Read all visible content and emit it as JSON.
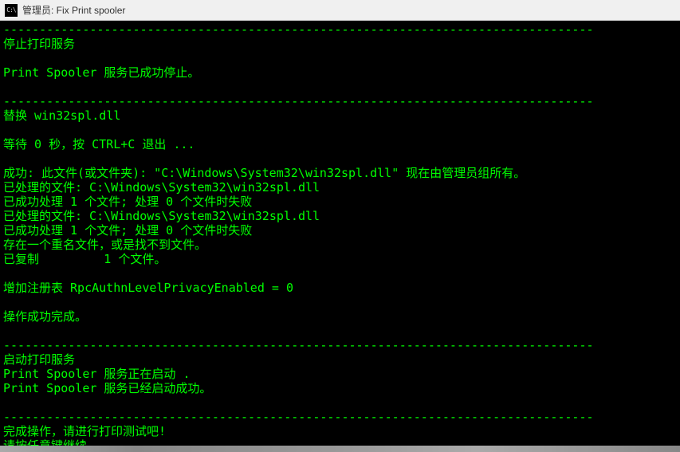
{
  "titlebar": {
    "icon_label": "C:\\",
    "title": "管理员:  Fix Print spooler"
  },
  "terminal": {
    "divider": "----------------------------------------------------------------------------------",
    "lines": {
      "l01": "停止打印服务",
      "l02": "",
      "l03": "Print Spooler 服务已成功停止。",
      "l04": "",
      "l05": "替换 win32spl.dll",
      "l06": "",
      "l07": "等待 0 秒，按 CTRL+C 退出 ...",
      "l08": "",
      "l09": "成功: 此文件(或文件夹): \"C:\\Windows\\System32\\win32spl.dll\" 现在由管理员组所有。",
      "l10": "已处理的文件: C:\\Windows\\System32\\win32spl.dll",
      "l11": "已成功处理 1 个文件; 处理 0 个文件时失败",
      "l12": "已处理的文件: C:\\Windows\\System32\\win32spl.dll",
      "l13": "已成功处理 1 个文件; 处理 0 个文件时失败",
      "l14": "存在一个重名文件，或是找不到文件。",
      "l15": "已复制         1 个文件。",
      "l16": "",
      "l17": "增加注册表 RpcAuthnLevelPrivacyEnabled = 0",
      "l18": "",
      "l19": "操作成功完成。",
      "l20": "",
      "l21": "启动打印服务",
      "l22": "Print Spooler 服务正在启动 .",
      "l23": "Print Spooler 服务已经启动成功。",
      "l24": "",
      "l25": "完成操作，请进行打印测试吧!",
      "l26": "请按任意键继续. . ."
    }
  }
}
